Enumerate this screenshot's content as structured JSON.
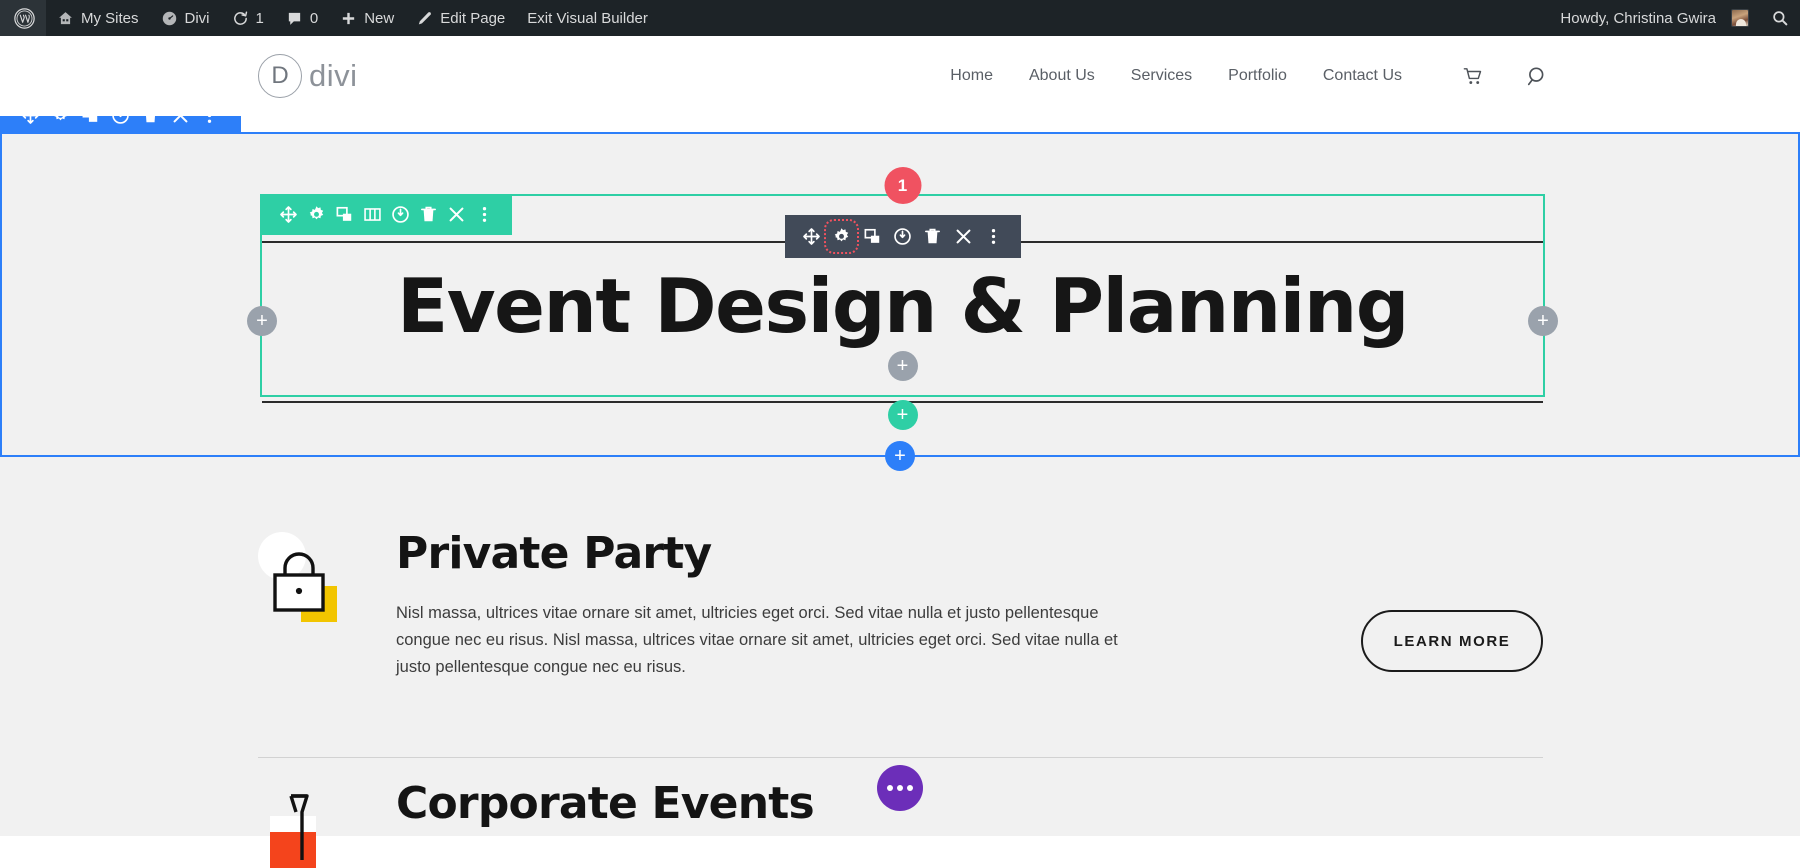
{
  "adminbar": {
    "wp_logo": "wordpress-icon",
    "items": [
      {
        "label": "My Sites",
        "icon": "sites-icon"
      },
      {
        "label": "Divi",
        "icon": "divi-dashboard-icon"
      },
      {
        "label": "1",
        "icon": "updates-icon"
      },
      {
        "label": "0",
        "icon": "comments-icon"
      },
      {
        "label": "New",
        "icon": "plus-icon"
      },
      {
        "label": "Edit Page",
        "icon": "pencil-icon"
      },
      {
        "label": "Exit Visual Builder",
        "icon": ""
      }
    ],
    "howdy": "Howdy, Christina Gwira",
    "search_icon": "search-icon"
  },
  "site_header": {
    "logo_letter": "D",
    "logo_word": "divi",
    "nav": [
      {
        "label": "Home"
      },
      {
        "label": "About Us"
      },
      {
        "label": "Services"
      },
      {
        "label": "Portfolio"
      },
      {
        "label": "Contact Us"
      }
    ],
    "cart_icon": "cart-icon",
    "search_icon": "search-icon"
  },
  "builder": {
    "section_color": "#2d7ff9",
    "row_color": "#2ecfa5",
    "module_color": "#414a58",
    "highlight_color": "#f0525f",
    "badge_label": "1",
    "section_toolbar": [
      {
        "name": "move-handle-icon",
        "glyph": "move"
      },
      {
        "name": "gear-icon",
        "glyph": "gear"
      },
      {
        "name": "duplicate-icon",
        "glyph": "duplicate"
      },
      {
        "name": "save-to-library-icon",
        "glyph": "power"
      },
      {
        "name": "trash-icon",
        "glyph": "trash"
      },
      {
        "name": "close-icon",
        "glyph": "close"
      },
      {
        "name": "more-options-icon",
        "glyph": "dots"
      }
    ],
    "row_toolbar": [
      {
        "name": "move-handle-icon",
        "glyph": "move"
      },
      {
        "name": "gear-icon",
        "glyph": "gear"
      },
      {
        "name": "duplicate-icon",
        "glyph": "duplicate"
      },
      {
        "name": "column-structure-icon",
        "glyph": "columns"
      },
      {
        "name": "save-to-library-icon",
        "glyph": "power"
      },
      {
        "name": "trash-icon",
        "glyph": "trash"
      },
      {
        "name": "close-icon",
        "glyph": "close"
      },
      {
        "name": "more-options-icon",
        "glyph": "dots"
      }
    ],
    "module_toolbar": [
      {
        "name": "move-handle-icon",
        "glyph": "move"
      },
      {
        "name": "gear-icon",
        "glyph": "gear",
        "highlighted": true
      },
      {
        "name": "duplicate-icon",
        "glyph": "duplicate"
      },
      {
        "name": "save-to-library-icon",
        "glyph": "power"
      },
      {
        "name": "trash-icon",
        "glyph": "trash"
      },
      {
        "name": "close-icon",
        "glyph": "close"
      },
      {
        "name": "more-options-icon",
        "glyph": "dots"
      }
    ],
    "add_buttons": {
      "left": "+",
      "right": "+",
      "center": "+",
      "row": "+",
      "section": "+"
    }
  },
  "hero": {
    "title": "Event Design & Planning"
  },
  "cards": [
    {
      "icon": "lock-icon",
      "title": "Private Party",
      "text": "Nisl massa, ultrices vitae ornare sit amet, ultricies eget orci. Sed vitae nulla et justo pellentesque congue nec eu risus. Nisl massa, ultrices vitae ornare sit amet, ultricies eget orci. Sed vitae nulla et justo pellentesque congue nec eu risus.",
      "button": "LEARN MORE"
    },
    {
      "icon": "cocktail-icon",
      "title": "Corporate Events",
      "text": "",
      "button": ""
    }
  ],
  "fab": {
    "name": "divi-menu-button",
    "color": "#6c2eb9"
  }
}
